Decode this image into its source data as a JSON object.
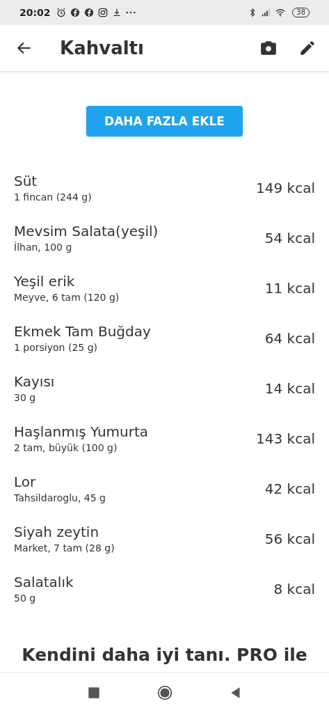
{
  "status_bar": {
    "time": "20:02",
    "battery": "38"
  },
  "header": {
    "title": "Kahvaltı"
  },
  "add_button": {
    "label": "DAHA FAZLA EKLE"
  },
  "foods": [
    {
      "name": "Süt",
      "detail": "1 fincan (244 g)",
      "calories": "149 kcal"
    },
    {
      "name": "Mevsim Salata(yeşil)",
      "detail": "İlhan, 100 g",
      "calories": "54 kcal"
    },
    {
      "name": "Yeşil erik",
      "detail": "Meyve, 6 tam (120 g)",
      "calories": "11 kcal"
    },
    {
      "name": "Ekmek Tam Buğday",
      "detail": "1 porsiyon (25 g)",
      "calories": "64 kcal"
    },
    {
      "name": "Kayısı",
      "detail": "30 g",
      "calories": "14 kcal"
    },
    {
      "name": "Haşlanmış Yumurta",
      "detail": "2 tam, büyük (100 g)",
      "calories": "143 kcal"
    },
    {
      "name": "Lor",
      "detail": "Tahsildaroglu, 45 g",
      "calories": "42 kcal"
    },
    {
      "name": "Siyah zeytin",
      "detail": "Market, 7 tam (28 g)",
      "calories": "56 kcal"
    },
    {
      "name": "Salatalık",
      "detail": "50 g",
      "calories": "8 kcal"
    }
  ],
  "promo": {
    "heading": "Kendini daha iyi tanı. PRO ile"
  }
}
